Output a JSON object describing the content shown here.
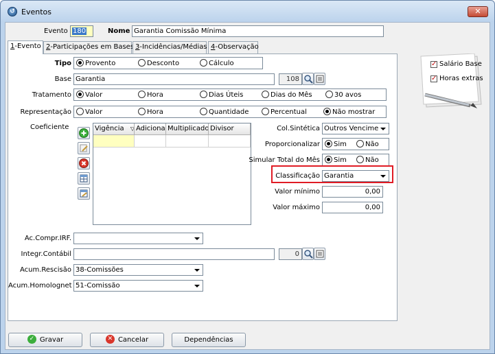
{
  "window": {
    "title": "Eventos",
    "close_glyph": "✕"
  },
  "header": {
    "evento_label": "Evento",
    "evento_value": "180",
    "nome_label": "Nome",
    "nome_value": "Garantia Comissão Mínima"
  },
  "tabs": [
    {
      "key": "1",
      "label": "-Evento"
    },
    {
      "key": "2",
      "label": "-Participações em Bases"
    },
    {
      "key": "3",
      "label": "-Incidências/Médias"
    },
    {
      "key": "4",
      "label": "-Observação"
    }
  ],
  "tipo": {
    "label": "Tipo",
    "options": [
      "Provento",
      "Desconto",
      "Cálculo"
    ],
    "selected": 0
  },
  "base": {
    "label": "Base",
    "value": "Garantia",
    "code": "108"
  },
  "tratamento": {
    "label": "Tratamento",
    "options": [
      "Valor",
      "Hora",
      "Dias Úteis",
      "Dias do Mês",
      "30 avos"
    ],
    "selected": 0
  },
  "representacao": {
    "label": "Representação",
    "options": [
      "Valor",
      "Hora",
      "Quantidade",
      "Percentual",
      "Não mostrar"
    ],
    "selected": 4
  },
  "coeficiente": {
    "label": "Coeficiente",
    "columns": [
      "Vigência",
      "Adicional",
      "Multiplicador",
      "Divisor"
    ]
  },
  "right": {
    "col_sintetica_label": "Col.Sintética",
    "col_sintetica_value": "Outros Vencime",
    "proporcionalizar_label": "Proporcionalizar",
    "proporcionalizar_options": [
      "Sim",
      "Não"
    ],
    "proporcionalizar_selected": 0,
    "simular_label": "Simular Total do Mês",
    "simular_options": [
      "Sim",
      "Não"
    ],
    "simular_selected": 0,
    "classificacao_label": "Classificação",
    "classificacao_value": "Garantia",
    "valor_minimo_label": "Valor mínimo",
    "valor_minimo_value": "0,00",
    "valor_maximo_label": "Valor máximo",
    "valor_maximo_value": "0,00"
  },
  "bottom_fields": {
    "ac_compr_label": "Ac.Compr.IRF.",
    "ac_compr_value": "",
    "integr_label": "Integr.Contábil",
    "integr_value": "",
    "integr_code": "0",
    "acum_rescisao_label": "Acum.Rescisão",
    "acum_rescisao_value": "38-Comissões",
    "acum_homolognet_label": "Acum.Homolognet",
    "acum_homolognet_value": "51-Comissão"
  },
  "notepad": {
    "items": [
      "Salário Base",
      "Horas extras"
    ]
  },
  "buttons": {
    "save": "Gravar",
    "cancel": "Cancelar",
    "deps": "Dependências"
  },
  "colors": {
    "highlight": "#e01b24",
    "evento_field": "#ffffc0",
    "grid_selected_cell": "#ffffc0"
  }
}
